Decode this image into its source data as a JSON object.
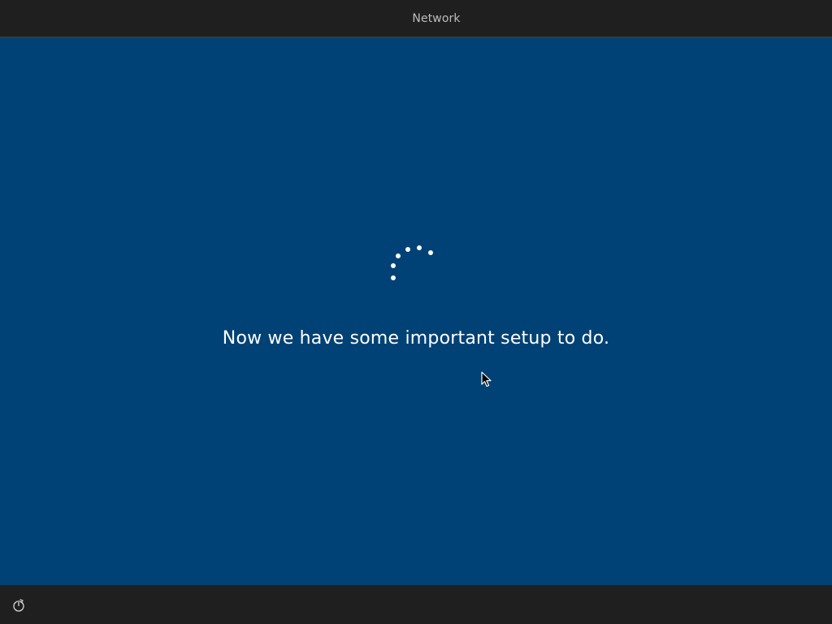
{
  "header": {
    "tabs": [
      {
        "label": "Network",
        "active": true
      }
    ]
  },
  "main": {
    "message": "Now we have some important setup to do.",
    "spinner_icon": "loading-spinner-icon"
  },
  "footer": {
    "accessibility_icon": "ease-of-access-icon"
  },
  "colors": {
    "background": "#004275",
    "bar_background": "#1f1f1f",
    "text": "#ffffff",
    "tab_text": "#bdbdbd"
  }
}
